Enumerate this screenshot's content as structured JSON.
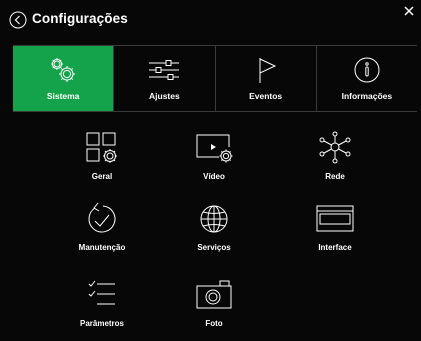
{
  "window": {
    "title": "Configurações"
  },
  "tabs": [
    {
      "label": "Sistema",
      "icon": "gears-icon",
      "active": true
    },
    {
      "label": "Ajustes",
      "icon": "sliders-icon",
      "active": false
    },
    {
      "label": "Eventos",
      "icon": "flag-icon",
      "active": false
    },
    {
      "label": "Informações",
      "icon": "info-icon",
      "active": false
    }
  ],
  "items": [
    {
      "label": "Geral",
      "icon": "grid-gear-icon"
    },
    {
      "label": "Vídeo",
      "icon": "video-gear-icon"
    },
    {
      "label": "Rede",
      "icon": "network-icon"
    },
    {
      "label": "Manutenção",
      "icon": "refresh-check-icon"
    },
    {
      "label": "Serviços",
      "icon": "globe-icon"
    },
    {
      "label": "Interface",
      "icon": "window-icon"
    },
    {
      "label": "Parâmetros",
      "icon": "checklist-icon"
    },
    {
      "label": "Foto",
      "icon": "camera-icon"
    }
  ],
  "colors": {
    "background": "#070707",
    "active_tab": "#14a34a",
    "text": "#ffffff",
    "divider": "#3a3a3a"
  }
}
